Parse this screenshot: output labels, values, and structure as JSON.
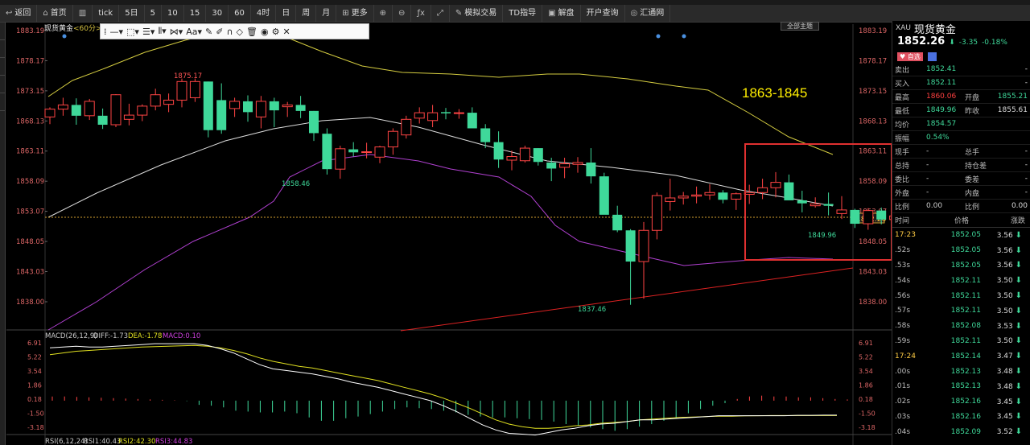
{
  "toolbar": {
    "items": [
      {
        "label": "返回",
        "icon": "back-icon"
      },
      {
        "label": "首页",
        "icon": "home-icon"
      },
      {
        "label": "",
        "icon": "chart-type-icon"
      },
      {
        "label": "tick",
        "icon": ""
      },
      {
        "label": "5日",
        "icon": ""
      },
      {
        "label": "5",
        "icon": ""
      },
      {
        "label": "10",
        "icon": ""
      },
      {
        "label": "15",
        "icon": ""
      },
      {
        "label": "30",
        "icon": ""
      },
      {
        "label": "60",
        "icon": ""
      },
      {
        "label": "4时",
        "icon": ""
      },
      {
        "label": "日",
        "icon": ""
      },
      {
        "label": "周",
        "icon": ""
      },
      {
        "label": "月",
        "icon": ""
      },
      {
        "label": "更多",
        "icon": "grid-icon"
      },
      {
        "label": "",
        "icon": "zoom-in-icon"
      },
      {
        "label": "",
        "icon": "zoom-out-icon"
      },
      {
        "label": "",
        "icon": "formula-icon"
      },
      {
        "label": "",
        "icon": "fullscreen-icon"
      },
      {
        "label": "模拟交易",
        "icon": "pen-icon"
      },
      {
        "label": "TD指导",
        "icon": ""
      },
      {
        "label": "解盘",
        "icon": "chat-icon"
      },
      {
        "label": "开户查询",
        "icon": ""
      },
      {
        "label": "汇通网",
        "icon": "globe-icon"
      }
    ]
  },
  "chart": {
    "title": "现货黄金",
    "period": "<60分>",
    "theme_button": "全部主题",
    "annotation": "1863-1845",
    "current_price_label": "1852.26",
    "high_label": "1875.17",
    "low_labels": [
      "1858.46",
      "1837.46",
      "1849.96"
    ],
    "y_ticks": [
      "1883.19",
      "1878.17",
      "1873.15",
      "1868.13",
      "1863.11",
      "1858.09",
      "1853.07",
      "1848.05",
      "1843.03",
      "1838.00"
    ],
    "macd_legend": {
      "name": "MACD(26,12,9)",
      "diff": "DIFF:-1.73",
      "dea": "DEA:-1.78",
      "macd": "MACD:0.10"
    },
    "macd_ticks": [
      "6.91",
      "5.22",
      "3.54",
      "1.86",
      "0.18",
      "-1.50",
      "-3.18"
    ],
    "rsi_legend": {
      "name": "RSI(6,12,24)",
      "rsi1": "RSI1:40.43",
      "rsi2": "RSI2:42.30",
      "rsi3": "RSI3:44.83"
    }
  },
  "chart_data": {
    "type": "candlestick",
    "title": "现货黄金 <60分>",
    "ylim": [
      1835.5,
      1885.5
    ],
    "candles": [
      [
        1868.8,
        1870.4,
        1867.6,
        1870.1
      ],
      [
        1870.1,
        1872.0,
        1869.0,
        1870.8
      ],
      [
        1870.8,
        1871.9,
        1867.5,
        1869.0
      ],
      [
        1869.0,
        1871.8,
        1868.3,
        1871.4
      ],
      [
        1869.0,
        1870.2,
        1866.8,
        1867.5
      ],
      [
        1867.5,
        1872.6,
        1867.1,
        1872.5
      ],
      [
        1868.4,
        1871.0,
        1867.4,
        1869.1
      ],
      [
        1869.1,
        1870.9,
        1868.1,
        1870.6
      ],
      [
        1870.6,
        1873.5,
        1869.9,
        1872.5
      ],
      [
        1870.9,
        1872.7,
        1869.6,
        1871.6
      ],
      [
        1871.6,
        1875.2,
        1870.4,
        1874.7
      ],
      [
        1872.0,
        1875.2,
        1871.3,
        1874.7
      ],
      [
        1874.7,
        1874.7,
        1865.4,
        1866.6
      ],
      [
        1871.6,
        1874.4,
        1866.0,
        1866.6
      ],
      [
        1870.2,
        1872.0,
        1868.8,
        1871.4
      ],
      [
        1871.4,
        1872.4,
        1868.0,
        1869.6
      ],
      [
        1868.8,
        1872.3,
        1866.9,
        1871.4
      ],
      [
        1871.4,
        1872.0,
        1867.1,
        1869.9
      ],
      [
        1870.5,
        1871.3,
        1868.8,
        1870.8
      ],
      [
        1870.8,
        1872.3,
        1868.6,
        1869.8
      ],
      [
        1869.8,
        1869.8,
        1864.8,
        1866.1
      ],
      [
        1866.0,
        1866.9,
        1859.2,
        1860.1
      ],
      [
        1860.1,
        1864.0,
        1858.5,
        1863.5
      ],
      [
        1863.4,
        1864.6,
        1862.2,
        1862.9
      ],
      [
        1863.0,
        1864.5,
        1861.9,
        1863.0
      ],
      [
        1862.1,
        1864.0,
        1861.1,
        1863.8
      ],
      [
        1863.8,
        1866.9,
        1862.5,
        1866.4
      ],
      [
        1865.8,
        1869.0,
        1865.2,
        1868.4
      ],
      [
        1868.6,
        1870.4,
        1867.7,
        1869.5
      ],
      [
        1868.2,
        1870.8,
        1867.1,
        1869.5
      ],
      [
        1869.6,
        1870.3,
        1868.4,
        1869.4
      ],
      [
        1869.5,
        1870.1,
        1868.5,
        1869.5
      ],
      [
        1869.5,
        1870.4,
        1867.0,
        1866.9
      ],
      [
        1866.9,
        1867.6,
        1863.6,
        1864.6
      ],
      [
        1864.6,
        1866.4,
        1860.3,
        1861.7
      ],
      [
        1861.6,
        1863.2,
        1859.9,
        1862.2
      ],
      [
        1861.5,
        1864.0,
        1861.2,
        1863.6
      ],
      [
        1863.6,
        1863.6,
        1860.7,
        1861.3
      ],
      [
        1861.2,
        1862.0,
        1858.1,
        1860.2
      ],
      [
        1860.4,
        1862.0,
        1858.6,
        1861.0
      ],
      [
        1860.9,
        1862.1,
        1859.5,
        1861.2
      ],
      [
        1861.2,
        1863.6,
        1857.7,
        1858.9
      ],
      [
        1858.9,
        1859.5,
        1855.4,
        1852.5
      ],
      [
        1852.5,
        1854.0,
        1849.6,
        1849.9
      ],
      [
        1849.9,
        1850.1,
        1837.5,
        1844.7
      ],
      [
        1844.7,
        1851.3,
        1838.5,
        1849.9
      ],
      [
        1849.9,
        1856.2,
        1848.4,
        1855.7
      ],
      [
        1854.7,
        1858.5,
        1853.2,
        1855.3
      ],
      [
        1855.3,
        1856.3,
        1854.2,
        1855.6
      ],
      [
        1855.6,
        1857.2,
        1854.4,
        1855.8
      ],
      [
        1855.8,
        1857.6,
        1855.0,
        1856.2
      ],
      [
        1856.2,
        1856.6,
        1854.4,
        1855.0
      ],
      [
        1855.1,
        1856.2,
        1853.3,
        1856.0
      ],
      [
        1855.9,
        1857.5,
        1854.3,
        1856.2
      ],
      [
        1856.2,
        1858.5,
        1855.1,
        1857.0
      ],
      [
        1857.0,
        1859.6,
        1855.4,
        1857.9
      ],
      [
        1857.9,
        1859.2,
        1855.2,
        1854.9
      ],
      [
        1854.9,
        1856.5,
        1852.9,
        1854.4
      ],
      [
        1854.0,
        1855.4,
        1853.7,
        1854.3
      ],
      [
        1854.3,
        1856.2,
        1852.4,
        1854.0
      ],
      [
        1852.7,
        1855.6,
        1851.8,
        1853.3
      ],
      [
        1853.3,
        1853.5,
        1850.3,
        1851.0
      ],
      [
        1851.0,
        1853.6,
        1850.0,
        1853.2
      ],
      [
        1853.2,
        1853.7,
        1850.9,
        1851.7
      ],
      [
        1851.7,
        1852.6,
        1850.1,
        1852.3
      ]
    ],
    "macd_hist": [
      0.5,
      0.5,
      0.45,
      0.4,
      0.35,
      0.3,
      0.25,
      0.2,
      0.15,
      0.1,
      0.05,
      -0.05,
      -0.5,
      -0.6,
      -0.8,
      -1.2,
      -1.3,
      -1.4,
      -1.4,
      -1.3,
      -1.5,
      -2.0,
      -2.4,
      -2.4,
      -2.1,
      -1.9,
      -1.6,
      -1.3,
      -1.0,
      -0.8,
      -0.9,
      -1.0,
      -1.2,
      -1.4,
      -1.7,
      -1.9,
      -2.0,
      -2.0,
      -2.1,
      -2.2,
      -2.3,
      -2.5,
      -2.8,
      -3.0,
      -3.2,
      -3.4,
      -3.6,
      -3.4,
      -3.1,
      -2.8,
      -2.4,
      -2.0,
      -1.5,
      -1.0,
      -0.6,
      -0.3,
      0.2,
      0.5,
      0.6,
      0.5,
      0.5,
      0.4,
      0.4,
      0.3,
      0.2,
      0.15
    ],
    "diff_line": [
      6.3,
      6.4,
      6.5,
      6.4,
      6.4,
      6.5,
      6.6,
      6.7,
      6.8,
      6.8,
      6.8,
      6.8,
      6.6,
      6.2,
      5.7,
      5.0,
      4.3,
      3.8,
      3.6,
      3.4,
      3.2,
      2.9,
      2.6,
      2.2,
      1.9,
      1.6,
      1.2,
      0.8,
      0.4,
      0.0,
      -0.6,
      -1.3,
      -2.1,
      -2.9,
      -3.5,
      -3.9,
      -4.0,
      -4.1,
      -3.8,
      -3.5,
      -3.3,
      -3.0,
      -2.8,
      -2.7,
      -2.5,
      -2.3,
      -2.3,
      -2.2,
      -2.1,
      -2.0,
      -1.9,
      -1.8,
      -1.8,
      -1.8,
      -1.8,
      -1.8,
      -1.8,
      -1.75,
      -1.75,
      -1.73,
      -1.73
    ],
    "dea_line": [
      5.5,
      5.7,
      5.9,
      6.0,
      6.1,
      6.2,
      6.3,
      6.4,
      6.45,
      6.5,
      6.55,
      6.6,
      6.5,
      6.3,
      6.0,
      5.6,
      5.1,
      4.7,
      4.4,
      4.1,
      3.9,
      3.6,
      3.3,
      3.0,
      2.7,
      2.4,
      2.0,
      1.6,
      1.2,
      0.8,
      0.3,
      -0.3,
      -0.9,
      -1.6,
      -2.3,
      -2.8,
      -3.1,
      -3.3,
      -3.3,
      -3.2,
      -3.0,
      -2.9,
      -2.7,
      -2.6,
      -2.5,
      -2.3,
      -2.2,
      -2.1,
      -2.0,
      -1.95,
      -1.9,
      -1.85,
      -1.85,
      -1.82,
      -1.8,
      -1.78,
      -1.78,
      -1.78,
      -1.78,
      -1.78,
      -1.78
    ]
  },
  "quote": {
    "code": "XAU",
    "name": "现货黄金",
    "price": "1852.26",
    "change": "-3.35",
    "pct": "-0.18%",
    "alert_btn": "自选",
    "rows": [
      {
        "l": "卖出",
        "v": "1852.41",
        "l2": "",
        "v2": "-"
      },
      {
        "l": "买入",
        "v": "1852.11",
        "l2": "",
        "v2": "-"
      },
      {
        "l": "最高",
        "v": "1860.06",
        "l2": "开盘",
        "v2": "1855.21"
      },
      {
        "l": "最低",
        "v": "1849.96",
        "l2": "昨收",
        "v2": "1855.61"
      },
      {
        "l": "均价",
        "v": "1854.57",
        "l2": "",
        "v2": ""
      },
      {
        "l": "振幅",
        "v": "0.54%",
        "l2": "",
        "v2": ""
      },
      {
        "l": "现手",
        "v": "-",
        "l2": "总手",
        "v2": "-"
      },
      {
        "l": "总持",
        "v": "-",
        "l2": "持仓差",
        "v2": "-"
      },
      {
        "l": "委比",
        "v": "-",
        "l2": "委差",
        "v2": "-"
      },
      {
        "l": "外盘",
        "v": "-",
        "l2": "内盘",
        "v2": "-"
      },
      {
        "l": "比例",
        "v": "0.00",
        "l2": "比例",
        "v2": "0.00"
      }
    ]
  },
  "ticks": {
    "headers": [
      "时间",
      "价格",
      "涨跌"
    ],
    "rows": [
      {
        "t": "17:23",
        "p": "1852.05",
        "c": "3.56"
      },
      {
        "t": ".52s",
        "p": "1852.05",
        "c": "3.56"
      },
      {
        "t": ".53s",
        "p": "1852.05",
        "c": "3.56"
      },
      {
        "t": ".54s",
        "p": "1852.11",
        "c": "3.50"
      },
      {
        "t": ".56s",
        "p": "1852.11",
        "c": "3.50"
      },
      {
        "t": ".57s",
        "p": "1852.11",
        "c": "3.50"
      },
      {
        "t": ".58s",
        "p": "1852.08",
        "c": "3.53"
      },
      {
        "t": ".59s",
        "p": "1852.11",
        "c": "3.50"
      },
      {
        "t": "17:24",
        "p": "1852.14",
        "c": "3.47"
      },
      {
        "t": ".00s",
        "p": "1852.13",
        "c": "3.48"
      },
      {
        "t": ".01s",
        "p": "1852.13",
        "c": "3.48"
      },
      {
        "t": ".02s",
        "p": "1852.16",
        "c": "3.45"
      },
      {
        "t": ".03s",
        "p": "1852.16",
        "c": "3.45"
      },
      {
        "t": ".04s",
        "p": "1852.09",
        "c": "3.52"
      }
    ]
  },
  "colors": {
    "up": "#ff4444",
    "down": "#3fd99a",
    "accent": "#ffee00"
  }
}
